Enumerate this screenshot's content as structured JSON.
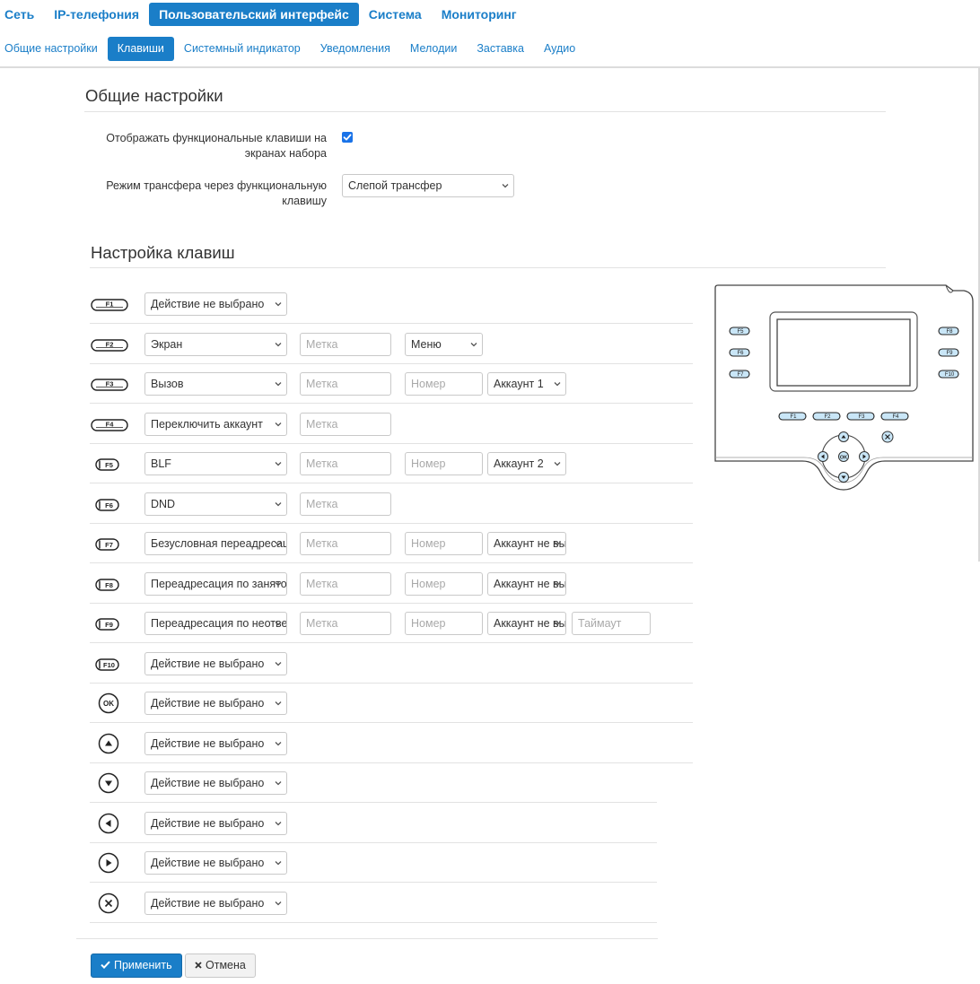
{
  "topnav": {
    "tabs": [
      {
        "label": "Сеть"
      },
      {
        "label": "IP-телефония"
      },
      {
        "label": "Пользовательский интерфейс",
        "active": true
      },
      {
        "label": "Система"
      },
      {
        "label": "Мониторинг"
      }
    ]
  },
  "subnav": {
    "tabs": [
      {
        "label": "Общие настройки"
      },
      {
        "label": "Клавиши",
        "active": true
      },
      {
        "label": "Системный индикатор"
      },
      {
        "label": "Уведомления"
      },
      {
        "label": "Мелодии"
      },
      {
        "label": "Заставка"
      },
      {
        "label": "Аудио"
      }
    ]
  },
  "general": {
    "title": "Общие настройки",
    "show_fkeys_label_1": "Отображать функциональные клавиши на",
    "show_fkeys_label_2": "экранах набора",
    "show_fkeys_checked": true,
    "transfer_label_1": "Режим трансфера через функциональную",
    "transfer_label_2": "клавишу",
    "transfer_value": "Слепой трансфер"
  },
  "keys": {
    "title": "Настройка клавиш",
    "rows": [
      {
        "key": "F1",
        "action": "Действие не выбрано"
      },
      {
        "key": "F2",
        "action": "Экран",
        "label_ph": "Метка",
        "extra": "Меню"
      },
      {
        "key": "F3",
        "action": "Вызов",
        "label_ph": "Метка",
        "number_ph": "Номер",
        "account": "Аккаунт 1"
      },
      {
        "key": "F4",
        "action": "Переключить аккаунт",
        "label_ph": "Метка"
      },
      {
        "key": "F5",
        "action": "BLF",
        "label_ph": "Метка",
        "number_ph": "Номер",
        "account": "Аккаунт 2"
      },
      {
        "key": "F6",
        "action": "DND",
        "label_ph": "Метка"
      },
      {
        "key": "F7",
        "action": "Безусловная переадресация",
        "label_ph": "Метка",
        "number_ph": "Номер",
        "account": "Аккаунт не выбран"
      },
      {
        "key": "F8",
        "action": "Переадресация по занятости",
        "label_ph": "Метка",
        "number_ph": "Номер",
        "account": "Аккаунт не выбран"
      },
      {
        "key": "F9",
        "action": "Переадресация по неответу",
        "label_ph": "Метка",
        "number_ph": "Номер",
        "account": "Аккаунт не выбран",
        "timeout_ph": "Таймаут"
      },
      {
        "key": "F10",
        "action": "Действие не выбрано"
      },
      {
        "key": "OK",
        "action": "Действие не выбрано"
      },
      {
        "key": "up",
        "action": "Действие не выбрано"
      },
      {
        "key": "down",
        "action": "Действие не выбрано"
      },
      {
        "key": "left",
        "action": "Действие не выбрано"
      },
      {
        "key": "right",
        "action": "Действие не выбрано"
      },
      {
        "key": "cancel",
        "action": "Действие не выбрано"
      }
    ]
  },
  "phone": {
    "left_keys": [
      "F5",
      "F6",
      "F7"
    ],
    "right_keys": [
      "F8",
      "F9",
      "F10"
    ],
    "bottom_keys": [
      "F1",
      "F2",
      "F3",
      "F4"
    ],
    "ok_label": "OK"
  },
  "actions": {
    "apply": "Применить",
    "cancel": "Отмена"
  },
  "colors": {
    "accent": "#1a7ec8",
    "checkbox": "#1a73e8",
    "key_highlight": "#c9e6f7"
  }
}
